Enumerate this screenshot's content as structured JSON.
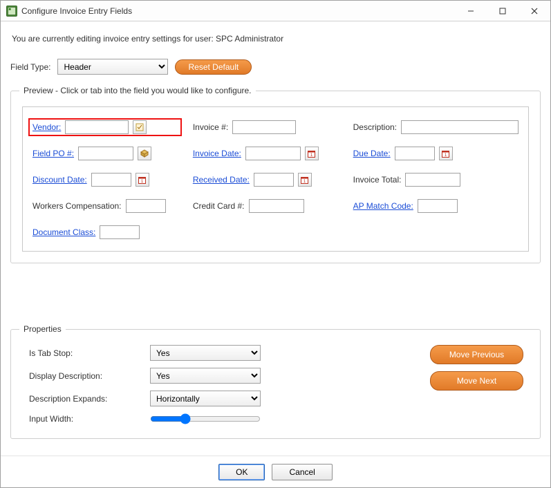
{
  "window": {
    "title": "Configure Invoice Entry Fields"
  },
  "info_text": "You are currently editing invoice entry settings for user: SPC Administrator",
  "field_type": {
    "label": "Field Type:",
    "value": "Header"
  },
  "reset_button": "Reset Default",
  "preview": {
    "legend": "Preview - Click or tab into the field you would like to configure.",
    "fields": {
      "vendor": "Vendor:",
      "invoice_no": "Invoice #:",
      "description": "Description:",
      "field_po": "Field PO #:",
      "invoice_date": "Invoice Date:",
      "due_date": "Due Date:",
      "discount_date": "Discount Date:",
      "received_date": "Received Date:",
      "invoice_total": "Invoice Total:",
      "workers_comp": "Workers Compensation:",
      "credit_card": "Credit Card #:",
      "ap_match_code": "AP Match Code:",
      "document_class": "Document Class:"
    }
  },
  "properties": {
    "legend": "Properties",
    "is_tab_stop": {
      "label": "Is Tab Stop:",
      "value": "Yes"
    },
    "display_description": {
      "label": "Display Description:",
      "value": "Yes"
    },
    "description_expands": {
      "label": "Description Expands:",
      "value": "Horizontally"
    },
    "input_width": {
      "label": "Input Width:",
      "value": 30
    },
    "move_previous": "Move Previous",
    "move_next": "Move Next"
  },
  "footer": {
    "ok": "OK",
    "cancel": "Cancel"
  }
}
